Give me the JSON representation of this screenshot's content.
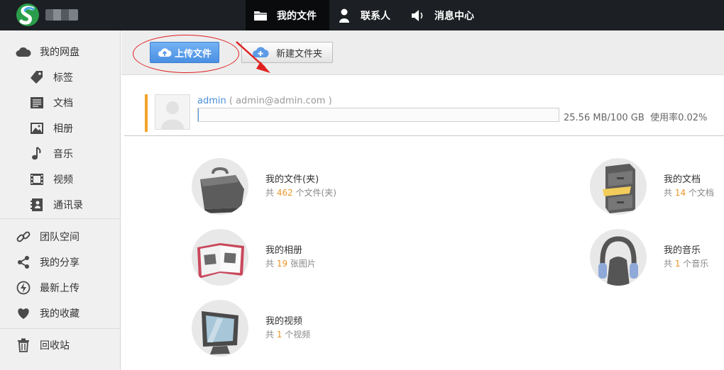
{
  "colors": {
    "topbar": "#1c1f23",
    "accent_orange": "#f2a22a",
    "upload_blue": "#4a8fe2",
    "link_blue": "#4a8fd8",
    "count_orange": "#e8962a"
  },
  "topnav": {
    "items": [
      {
        "label": "我的文件",
        "icon": "folder-icon",
        "active": true
      },
      {
        "label": "联系人",
        "icon": "person-icon",
        "active": false
      },
      {
        "label": "消息中心",
        "icon": "speaker-icon",
        "active": false
      }
    ]
  },
  "sidebar": {
    "items": [
      {
        "label": "我的网盘",
        "icon": "cloud-icon"
      },
      {
        "label": "标签",
        "icon": "tag-icon"
      },
      {
        "label": "文档",
        "icon": "document-icon"
      },
      {
        "label": "相册",
        "icon": "image-icon"
      },
      {
        "label": "音乐",
        "icon": "music-note-icon"
      },
      {
        "label": "视频",
        "icon": "film-icon"
      },
      {
        "label": "通讯录",
        "icon": "address-book-icon"
      },
      {
        "label": "团队空间",
        "icon": "link-icon"
      },
      {
        "label": "我的分享",
        "icon": "share-icon"
      },
      {
        "label": "最新上传",
        "icon": "lightning-icon"
      },
      {
        "label": "我的收藏",
        "icon": "heart-icon"
      },
      {
        "label": "回收站",
        "icon": "trash-icon"
      }
    ]
  },
  "toolbar": {
    "upload_label": "上传文件",
    "new_folder_label": "新建文件夹"
  },
  "user": {
    "name": "admin",
    "email_text": "( admin@admin.com )",
    "quota_text": "25.56 MB/100 GB",
    "usage_text": "使用率0.02%",
    "usage_percent": 0.02
  },
  "categories": [
    {
      "title": "我的文件(夹)",
      "prefix": "共 ",
      "count": "462",
      "suffix": " 个文件(夹)",
      "icon": "briefcase-icon"
    },
    {
      "title": "我的文档",
      "prefix": "共 ",
      "count": "14",
      "suffix": " 个文档",
      "icon": "file-cabinet-icon"
    },
    {
      "title": "我的相册",
      "prefix": "共 ",
      "count": "19",
      "suffix": " 张图片",
      "icon": "photo-album-icon"
    },
    {
      "title": "我的音乐",
      "prefix": "共 ",
      "count": "1",
      "suffix": " 个音乐",
      "icon": "headphones-icon"
    },
    {
      "title": "我的视频",
      "prefix": "共 ",
      "count": "1",
      "suffix": " 个视频",
      "icon": "monitor-icon"
    }
  ]
}
